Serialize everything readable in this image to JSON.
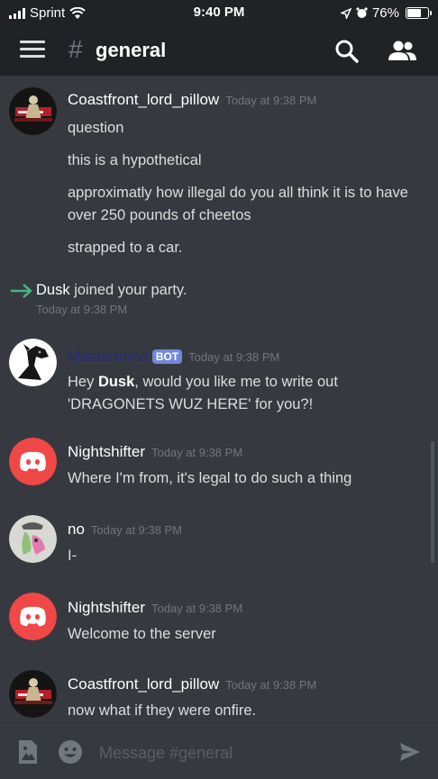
{
  "status_bar": {
    "carrier": "Sprint",
    "time": "9:40 PM",
    "battery_percent": "76%",
    "battery_level": 0.76,
    "icons": [
      "signal-icon",
      "wifi-icon",
      "location-arrow-icon",
      "alarm-icon",
      "battery-icon"
    ]
  },
  "header": {
    "hash": "#",
    "channel": "general",
    "icons": [
      "hamburger-menu-icon",
      "search-icon",
      "members-icon"
    ]
  },
  "messages": [
    {
      "author": "Coastfront_lord_pillow",
      "timestamp": "Today at 9:38 PM",
      "lines": [
        "question",
        "this is a hypothetical",
        "approximatly how illegal do you all think it is to have over 250 pounds of cheetos",
        "strapped to a car."
      ]
    },
    {
      "system": true,
      "user": "Dusk",
      "text": "joined your party.",
      "timestamp": "Today at 9:38 PM"
    },
    {
      "author": "Mastermind",
      "badge": "BOT",
      "timestamp": "Today at 9:38 PM",
      "lines_rich": {
        "pre": "Hey ",
        "bold": "Dusk",
        "post": ", would you like me to write out 'DRAGONETS WUZ HERE' for you?!"
      }
    },
    {
      "author": "Nightshifter",
      "timestamp": "Today at 9:38 PM",
      "lines": [
        "Where I'm from, it's legal to do such a thing"
      ]
    },
    {
      "author": "no",
      "timestamp": "Today at 9:38 PM",
      "lines": [
        "I-"
      ]
    },
    {
      "author": "Nightshifter",
      "timestamp": "Today at 9:38 PM",
      "lines": [
        "Welcome to the server"
      ]
    },
    {
      "author": "Coastfront_lord_pillow",
      "timestamp": "Today at 9:38 PM",
      "lines": [
        "now what if they were onfire."
      ]
    }
  ],
  "composer": {
    "placeholder": "Message #general",
    "icons": [
      "image-upload-icon",
      "emoji-icon",
      "send-icon"
    ]
  },
  "colors": {
    "background": "#36393f",
    "header": "#202225",
    "text": "#dcddde",
    "muted": "#72767d",
    "bot_badge": "#7289da",
    "discord_red": "#f04747",
    "join_green": "#43b581"
  }
}
